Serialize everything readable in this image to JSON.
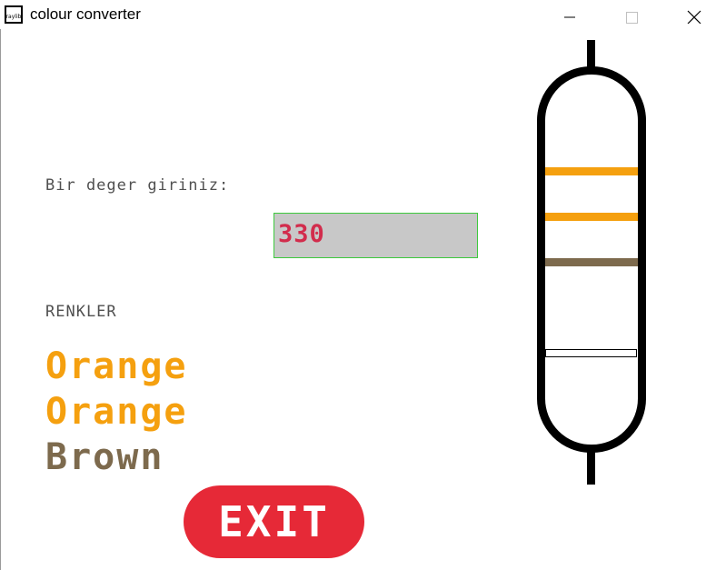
{
  "window": {
    "title": "colour converter",
    "icon_text": "raylib"
  },
  "form": {
    "prompt": "Bir deger giriniz:",
    "input_value": "330"
  },
  "colors": {
    "heading": "RENKLER",
    "items": [
      {
        "name": "Orange",
        "color": "#f5a00f"
      },
      {
        "name": "Orange",
        "color": "#f5a00f"
      },
      {
        "name": "Brown",
        "color": "#7d6a4d"
      }
    ]
  },
  "exit": {
    "label": "EXIT",
    "color": "#e62937"
  },
  "resistor": {
    "bands": [
      "#f5a00f",
      "#f5a00f",
      "#7d6a4d",
      "#ffffff"
    ]
  }
}
